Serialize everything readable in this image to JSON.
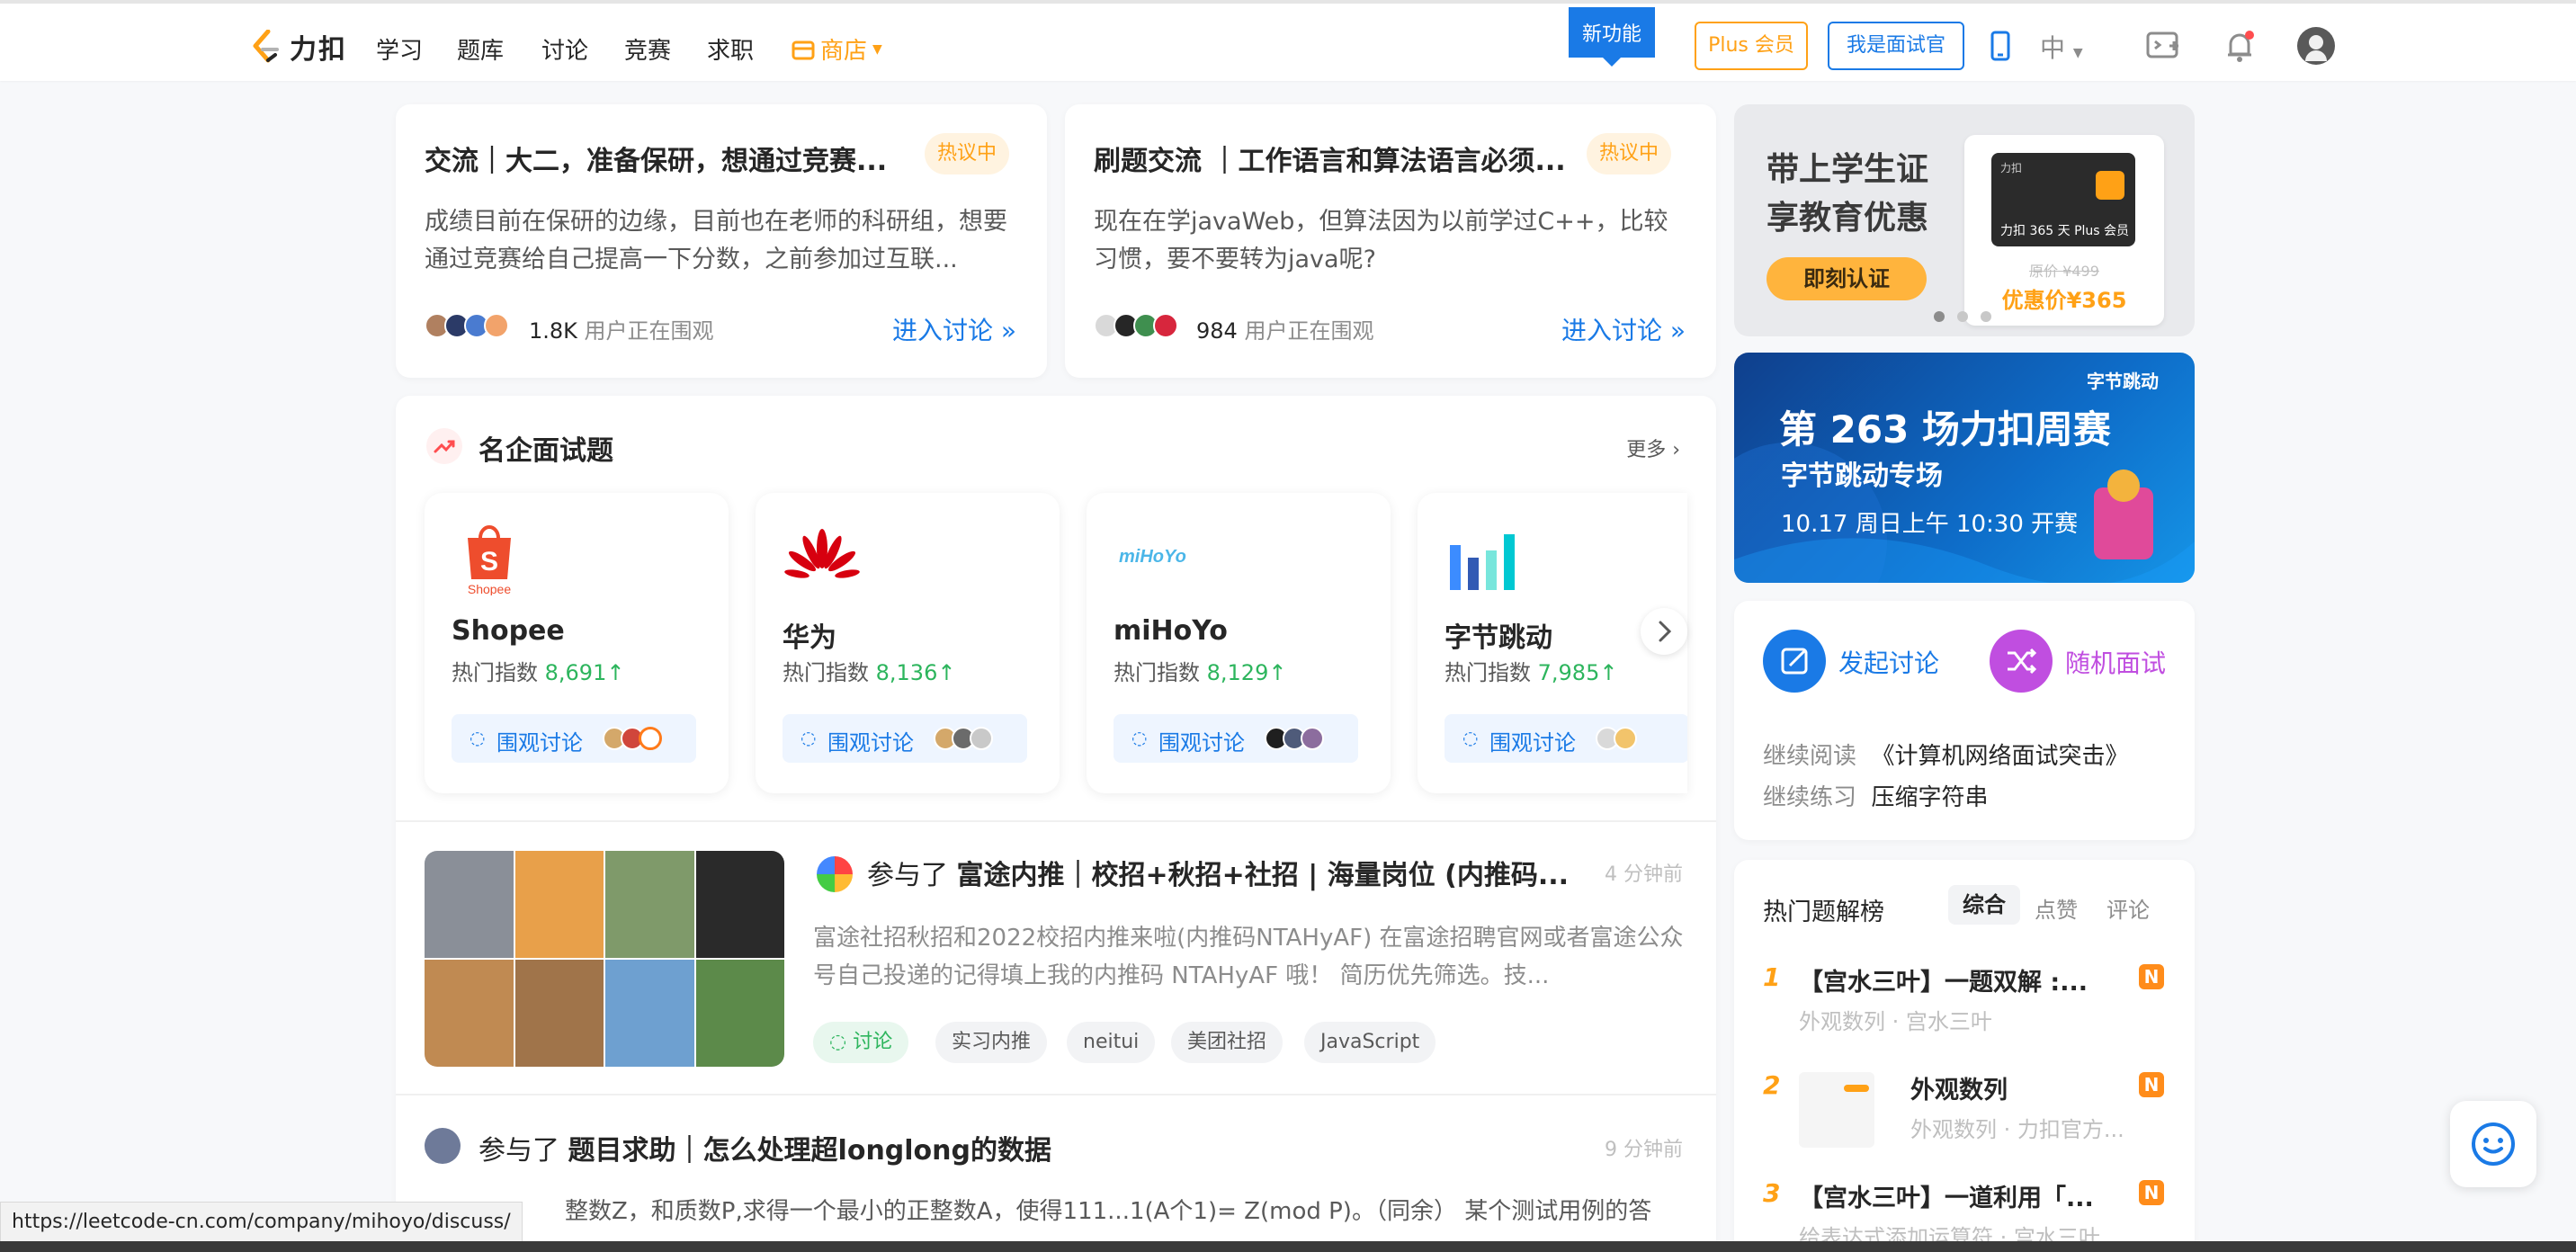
{
  "nav": {
    "logo_text": "力扣",
    "items": [
      "学习",
      "题库",
      "讨论",
      "竞赛",
      "求职"
    ],
    "shop": "商店",
    "new_feature": "新功能",
    "plus_button": "Plus 会员",
    "interviewer_button": "我是面试官",
    "language": "中"
  },
  "hot_discussions": [
    {
      "title": "交流｜大二，准备保研，想通过竞赛...",
      "badge": "热议中",
      "desc": "成绩目前在保研的边缘，目前也在老师的科研组，想要通过竞赛给自己提高一下分数，之前参加过互联...",
      "count": "1.8K",
      "watching_label": "用户正在围观",
      "enter": "进入讨论 »"
    },
    {
      "title": "刷题交流 ｜工作语言和算法语言必须...",
      "badge": "热议中",
      "desc": "现在在学javaWeb，但算法因为以前学过C++，比较习惯，要不要转为java呢?",
      "count": "984",
      "watching_label": "用户正在围观",
      "enter": "进入讨论 »"
    }
  ],
  "companies_section": {
    "title": "名企面试题",
    "more": "更多",
    "hot_label": "热门指数",
    "discuss_label": "围观讨论",
    "companies": [
      {
        "name": "Shopee",
        "index": "8,691↑"
      },
      {
        "name": "华为",
        "index": "8,136↑"
      },
      {
        "name": "miHoYo",
        "index": "8,129↑"
      },
      {
        "name": "字节跳动",
        "index": "7,985↑"
      }
    ]
  },
  "feed": [
    {
      "prefix": "参与了",
      "title": "富途内推｜校招+秋招+社招 | 海量岗位 (内推码...",
      "time": "4 分钟前",
      "desc": "富途社招秋招和2022校招内推来啦(内推码NTAHyAF) 在富途招聘官网或者富途公众号自己投递的记得填上我的内推码 NTAHyAF 哦！ 简历优先筛选。技...",
      "tags": [
        "讨论",
        "实习内推",
        "neitui",
        "美团社招",
        "JavaScript"
      ]
    },
    {
      "prefix": "参与了",
      "title": "题目求助｜怎么处理超longlong的数据",
      "time": "9 分钟前",
      "desc": "整数Z，和质数P,求得一个最小的正整数A，使得111...1(A个1)= Z(mod P)。（同余） 某个测试用例的答"
    }
  ],
  "promo": {
    "line1": "带上学生证",
    "line2": "享教育优惠",
    "cta": "即刻认证",
    "card_label": "力扣 365 天 Plus 会员",
    "orig_price": "原价 ¥499",
    "sale_price": "优惠价¥365"
  },
  "contest_banner": {
    "brand": "字节跳动",
    "title": "第 263 场力扣周赛",
    "subtitle": "字节跳动专场",
    "time": "10.17 周日上午 10:30 开赛"
  },
  "actions": {
    "start_discussion": "发起讨论",
    "random_interview": "随机面试",
    "continue_read_label": "继续阅读",
    "continue_read_value": "《计算机网络面试突击》",
    "continue_practice_label": "继续练习",
    "continue_practice_value": "压缩字符串"
  },
  "hot_solutions": {
    "title": "热门题解榜",
    "tabs": [
      "综合",
      "点赞",
      "评论"
    ],
    "items": [
      {
        "rank": "1",
        "title": "【宫水三叶】一题双解 :...",
        "meta": "外观数列 · 宫水三叶",
        "badge": "N"
      },
      {
        "rank": "2",
        "title": "外观数列",
        "meta": "外观数列 · 力扣官方...",
        "badge": "N"
      },
      {
        "rank": "3",
        "title": "【宫水三叶】一道利用「...",
        "meta": "给表达式添加运算符 · 宫水三叶",
        "badge": "N"
      }
    ]
  },
  "status_url": "https://leetcode-cn.com/company/mihoyo/discuss/",
  "colors": {
    "accent_blue": "#1a7ae6",
    "accent_orange": "#ffa116",
    "green": "#2db55d",
    "purple": "#c04ee0"
  }
}
